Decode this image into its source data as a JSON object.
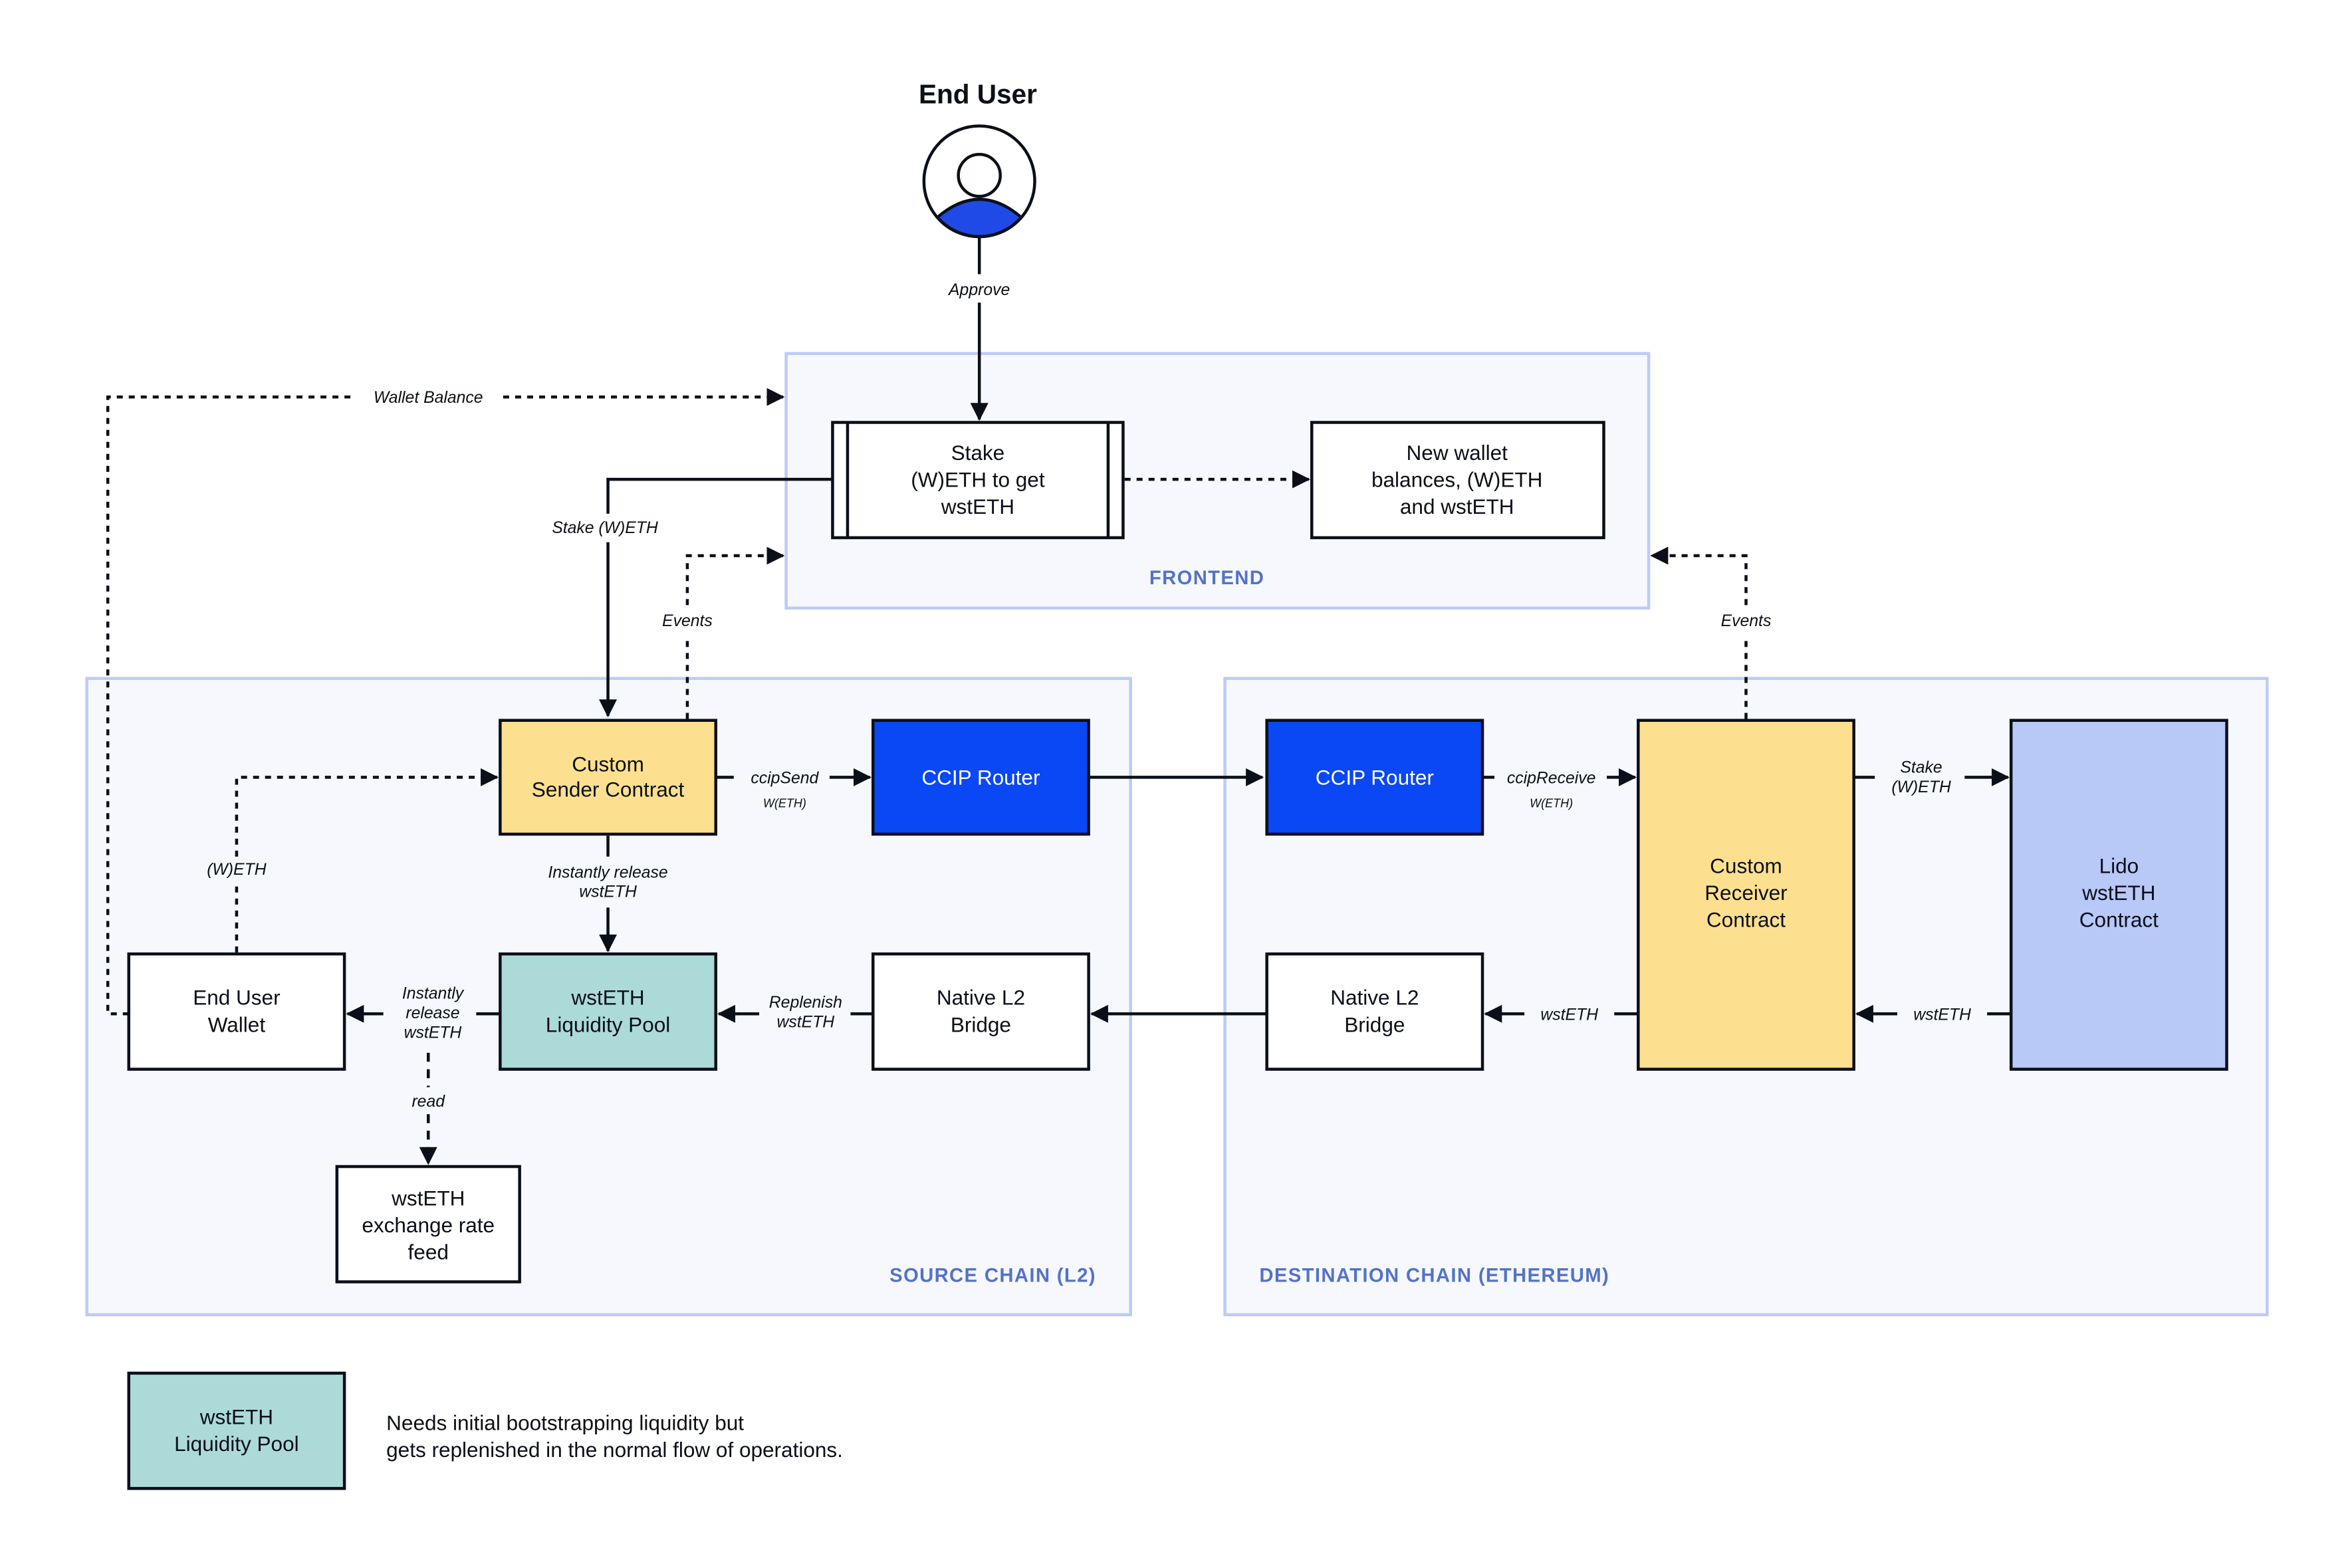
{
  "title": "End User",
  "colors": {
    "section_fill": "#f6f8fd",
    "section_border": "#bccbf6",
    "section_label": "#5473c7",
    "contract_yellow": "#fde08f",
    "router_blue": "#0a47f5",
    "pool_teal": "#acdad8",
    "lido_lavender": "#b8c8f7",
    "user_blue": "#1f4ae6",
    "ink": "#0b0f1a"
  },
  "sections": {
    "frontend": "FRONTEND",
    "source": "SOURCE CHAIN (L2)",
    "destination": "DESTINATION CHAIN (ETHEREUM)"
  },
  "nodes": {
    "stake": [
      "Stake",
      "(W)ETH to get",
      "wstETH"
    ],
    "new_wallet": [
      "New wallet",
      "balances, (W)ETH",
      "and wstETH"
    ],
    "sender": [
      "Custom",
      "Sender Contract"
    ],
    "ccip_router_src": [
      "CCIP Router"
    ],
    "end_user_wallet": [
      "End User",
      "Wallet"
    ],
    "liquidity_pool": [
      "wstETH",
      "Liquidity Pool"
    ],
    "native_bridge_src": [
      "Native L2",
      "Bridge"
    ],
    "exchange_feed": [
      "wstETH",
      "exchange rate",
      "feed"
    ],
    "ccip_router_dst": [
      "CCIP Router"
    ],
    "native_bridge_dst": [
      "Native L2",
      "Bridge"
    ],
    "receiver": [
      "Custom",
      "Receiver",
      "Contract"
    ],
    "lido": [
      "Lido",
      "wstETH",
      "Contract"
    ]
  },
  "edges": {
    "approve": "Approve",
    "wallet_balance": "Wallet Balance",
    "stake_weth": "Stake (W)ETH",
    "events_src": "Events",
    "events_dst": "Events",
    "weth_wallet": "(W)ETH",
    "ccip_send": "ccipSend",
    "ccip_send_sub": "W(ETH)",
    "instant_release_down": [
      "Instantly release",
      "wstETH"
    ],
    "instant_release_left": [
      "Instantly",
      "release",
      "wstETH"
    ],
    "replenish": [
      "Replenish",
      "wstETH"
    ],
    "read": "read",
    "ccip_receive": "ccipReceive",
    "ccip_receive_sub": "W(ETH)",
    "stake_lido": [
      "Stake",
      "(W)ETH"
    ],
    "wsteth_lido": "wstETH",
    "wsteth_bridge": "wstETH"
  },
  "legend": {
    "box": [
      "wstETH",
      "Liquidity Pool"
    ],
    "text": [
      "Needs initial bootstrapping liquidity but",
      "gets replenished in the normal flow of operations."
    ]
  }
}
